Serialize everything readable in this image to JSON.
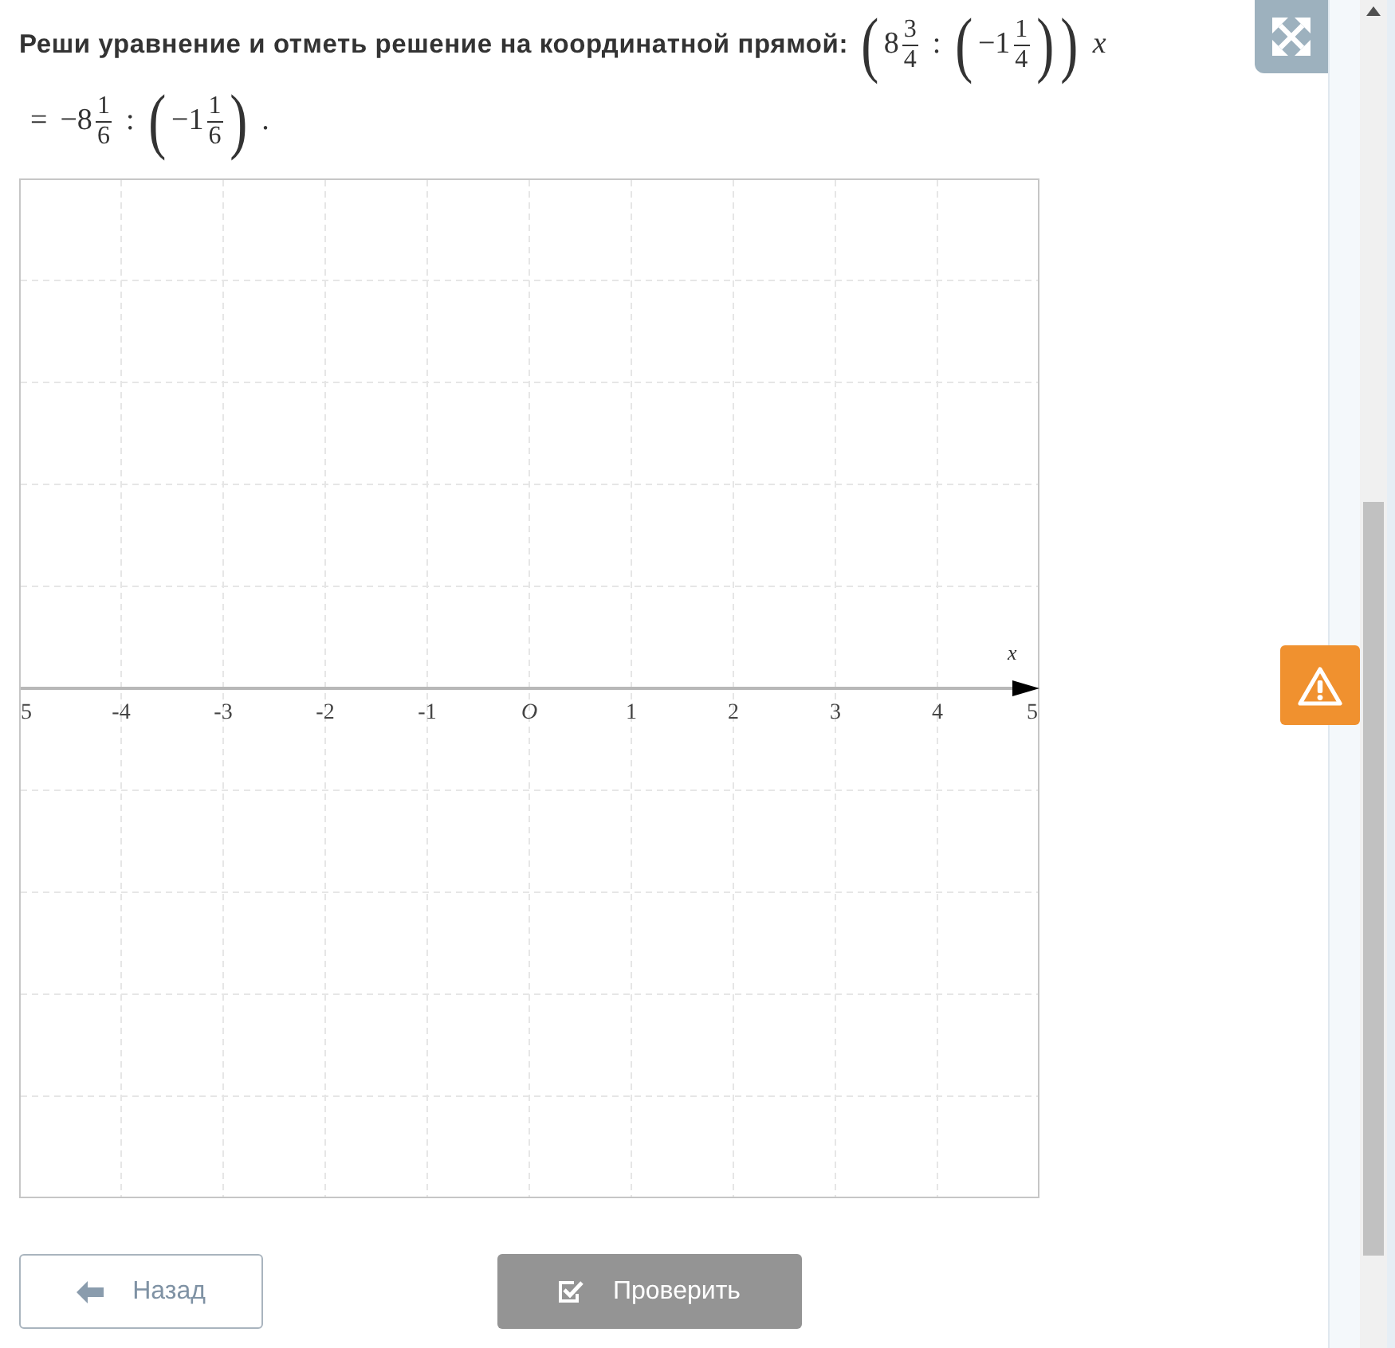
{
  "task": {
    "prompt": "Реши уравнение и отметь решение на координатной прямой:",
    "equation_lines": [
      [
        {
          "kind": "paren",
          "text": "("
        },
        {
          "kind": "number",
          "text": "8"
        },
        {
          "kind": "fraction",
          "numerator": "3",
          "denominator": "4"
        },
        {
          "kind": "operator",
          "text": ":"
        },
        {
          "kind": "paren",
          "text": "("
        },
        {
          "kind": "number",
          "text": "−1"
        },
        {
          "kind": "fraction",
          "numerator": "1",
          "denominator": "4"
        },
        {
          "kind": "paren",
          "text": ")"
        },
        {
          "kind": "paren",
          "text": ")"
        },
        {
          "kind": "variable",
          "text": "x"
        }
      ],
      [
        {
          "kind": "operator",
          "text": "="
        },
        {
          "kind": "number",
          "text": "−8"
        },
        {
          "kind": "fraction",
          "numerator": "1",
          "denominator": "6"
        },
        {
          "kind": "operator",
          "text": ":"
        },
        {
          "kind": "paren",
          "text": "("
        },
        {
          "kind": "number",
          "text": "−1"
        },
        {
          "kind": "fraction",
          "numerator": "1",
          "denominator": "6"
        },
        {
          "kind": "paren",
          "text": ")"
        },
        {
          "kind": "punct",
          "text": "."
        }
      ]
    ]
  },
  "number_line": {
    "axis_label": "x",
    "tick_labels": [
      {
        "kind": "number",
        "text": "5"
      },
      {
        "kind": "number",
        "text": "-4"
      },
      {
        "kind": "number",
        "text": "-3"
      },
      {
        "kind": "number",
        "text": "-2"
      },
      {
        "kind": "number",
        "text": "-1"
      },
      {
        "kind": "origin",
        "text": "O"
      },
      {
        "kind": "number",
        "text": "1"
      },
      {
        "kind": "number",
        "text": "2"
      },
      {
        "kind": "number",
        "text": "3"
      },
      {
        "kind": "number",
        "text": "4"
      },
      {
        "kind": "number",
        "text": "5"
      }
    ]
  },
  "buttons": [
    {
      "kind": "back",
      "label": "Назад",
      "disabled": false
    },
    {
      "kind": "check",
      "label": "Проверить",
      "disabled": true
    }
  ]
}
